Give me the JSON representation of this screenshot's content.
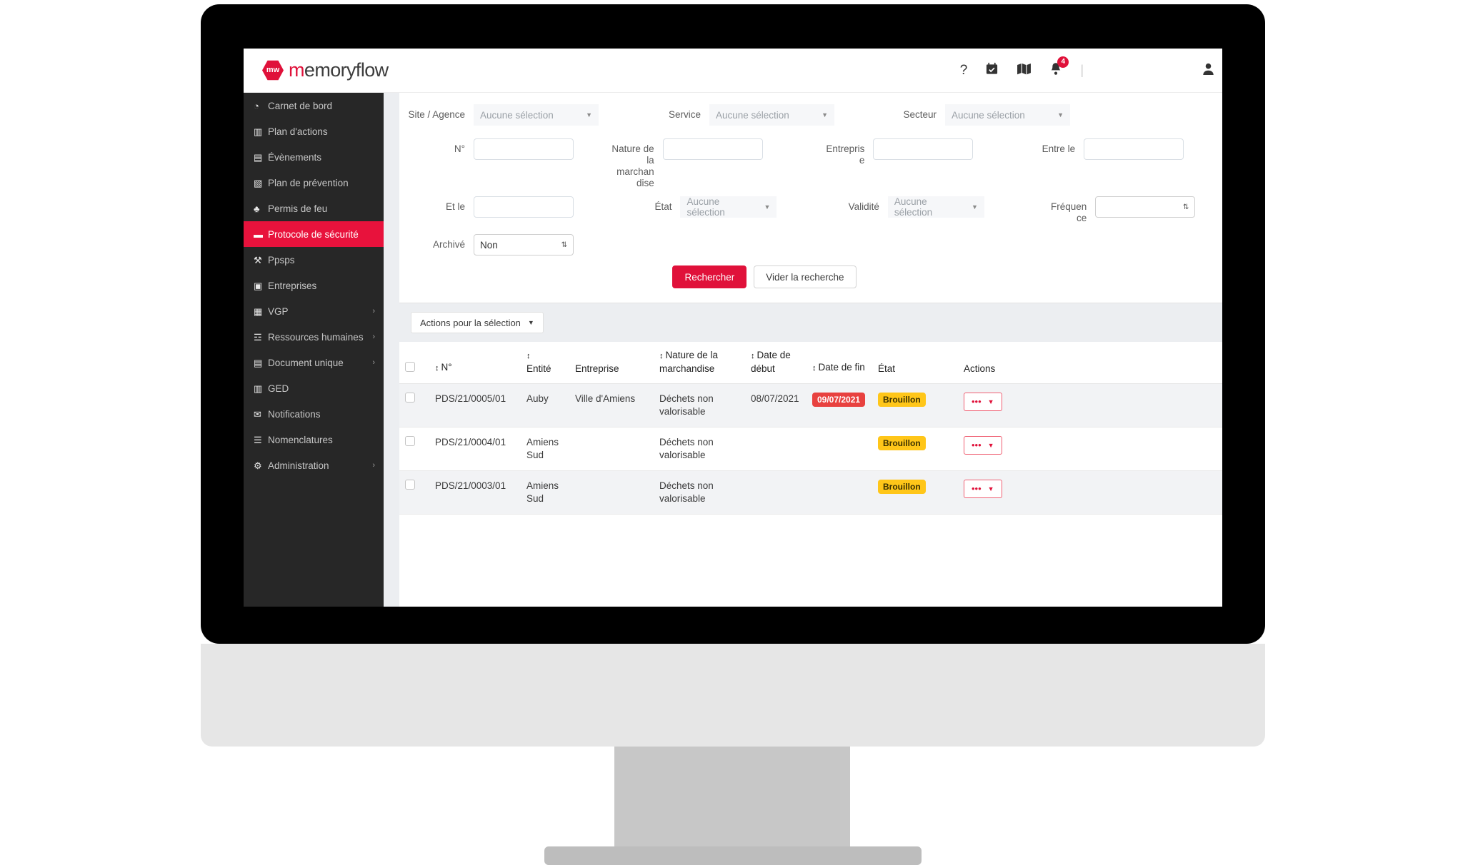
{
  "brand": {
    "mark": "mw",
    "name_first": "m",
    "name_rest": "emoryflow"
  },
  "topbar": {
    "help_icon": "?",
    "calendar_icon": "calendar-icon",
    "map_icon": "map-icon",
    "bell_icon": "bell-icon",
    "notification_count": "4",
    "separator": "|",
    "user_icon": "user-avatar-icon"
  },
  "sidebar": {
    "items": [
      {
        "label": "Carnet de bord",
        "icon": "◔",
        "active": false,
        "chevron": ""
      },
      {
        "label": "Plan d'actions",
        "icon": "▥",
        "active": false,
        "chevron": ""
      },
      {
        "label": "Évènements",
        "icon": "▤",
        "active": false,
        "chevron": ""
      },
      {
        "label": "Plan de prévention",
        "icon": "▧",
        "active": false,
        "chevron": ""
      },
      {
        "label": "Permis de feu",
        "icon": "♣",
        "active": false,
        "chevron": ""
      },
      {
        "label": "Protocole de sécurité",
        "icon": "▬",
        "active": true,
        "chevron": ""
      },
      {
        "label": "Ppsps",
        "icon": "⚒",
        "active": false,
        "chevron": ""
      },
      {
        "label": "Entreprises",
        "icon": "▣",
        "active": false,
        "chevron": ""
      },
      {
        "label": "VGP",
        "icon": "▦",
        "active": false,
        "chevron": "›"
      },
      {
        "label": "Ressources humaines",
        "icon": "☲",
        "active": false,
        "chevron": "›"
      },
      {
        "label": "Document unique",
        "icon": "▤",
        "active": false,
        "chevron": "›"
      },
      {
        "label": "GED",
        "icon": "▥",
        "active": false,
        "chevron": ""
      },
      {
        "label": "Notifications",
        "icon": "✉",
        "active": false,
        "chevron": ""
      },
      {
        "label": "Nomenclatures",
        "icon": "☰",
        "active": false,
        "chevron": ""
      },
      {
        "label": "Administration",
        "icon": "⚙",
        "active": false,
        "chevron": "›"
      }
    ]
  },
  "search_form": {
    "site_agence_label": "Site / Agence",
    "site_agence_value": "Aucune sélection",
    "service_label": "Service",
    "service_value": "Aucune sélection",
    "secteur_label": "Secteur",
    "secteur_value": "Aucune sélection",
    "numero_label": "N°",
    "numero_value": "",
    "nature_label": "Nature de la marchan dise",
    "nature_value": "",
    "entreprise_label": "Entrepris e",
    "entreprise_value": "",
    "entre_le_label": "Entre le",
    "entre_le_value": "",
    "et_le_label": "Et le",
    "et_le_value": "",
    "etat_label": "État",
    "etat_value": "Aucune sélection",
    "validite_label": "Validité",
    "validite_value": "Aucune sélection",
    "frequence_label": "Fréquen ce",
    "frequence_value": "",
    "archive_label": "Archivé",
    "archive_value": "Non",
    "search_button": "Rechercher",
    "clear_button": "Vider la recherche"
  },
  "list": {
    "bulk_actions_label": "Actions pour la sélection",
    "columns": [
      {
        "label": "N°",
        "sortable": true
      },
      {
        "label": "Entité",
        "sortable": true
      },
      {
        "label": "Entreprise",
        "sortable": false
      },
      {
        "label": "Nature de la marchandise",
        "sortable": true
      },
      {
        "label": "Date de début",
        "sortable": true
      },
      {
        "label": "Date de fin",
        "sortable": true
      },
      {
        "label": "État",
        "sortable": false
      },
      {
        "label": "Actions",
        "sortable": false
      }
    ],
    "rows": [
      {
        "numero": "PDS/21/0005/01",
        "entite": "Auby",
        "entreprise": "Ville d'Amiens",
        "nature": "Déchets non valorisable",
        "date_debut": "08/07/2021",
        "date_fin": "09/07/2021",
        "date_fin_style": "red",
        "etat": "Brouillon",
        "action_label": "•••"
      },
      {
        "numero": "PDS/21/0004/01",
        "entite": "Amiens Sud",
        "entreprise": "",
        "nature": "Déchets non valorisable",
        "date_debut": "",
        "date_fin": "",
        "date_fin_style": "none",
        "etat": "Brouillon",
        "action_label": "•••"
      },
      {
        "numero": "PDS/21/0003/01",
        "entite": "Amiens Sud",
        "entreprise": "",
        "nature": "Déchets non valorisable",
        "date_debut": "",
        "date_fin": "",
        "date_fin_style": "none",
        "etat": "Brouillon",
        "action_label": "•••"
      }
    ]
  },
  "colors": {
    "brand_red": "#e0113a",
    "active_nav": "#e8123c",
    "sidebar_bg": "#272727",
    "badge_red": "#e8413f",
    "badge_yellow": "#ffc619"
  }
}
